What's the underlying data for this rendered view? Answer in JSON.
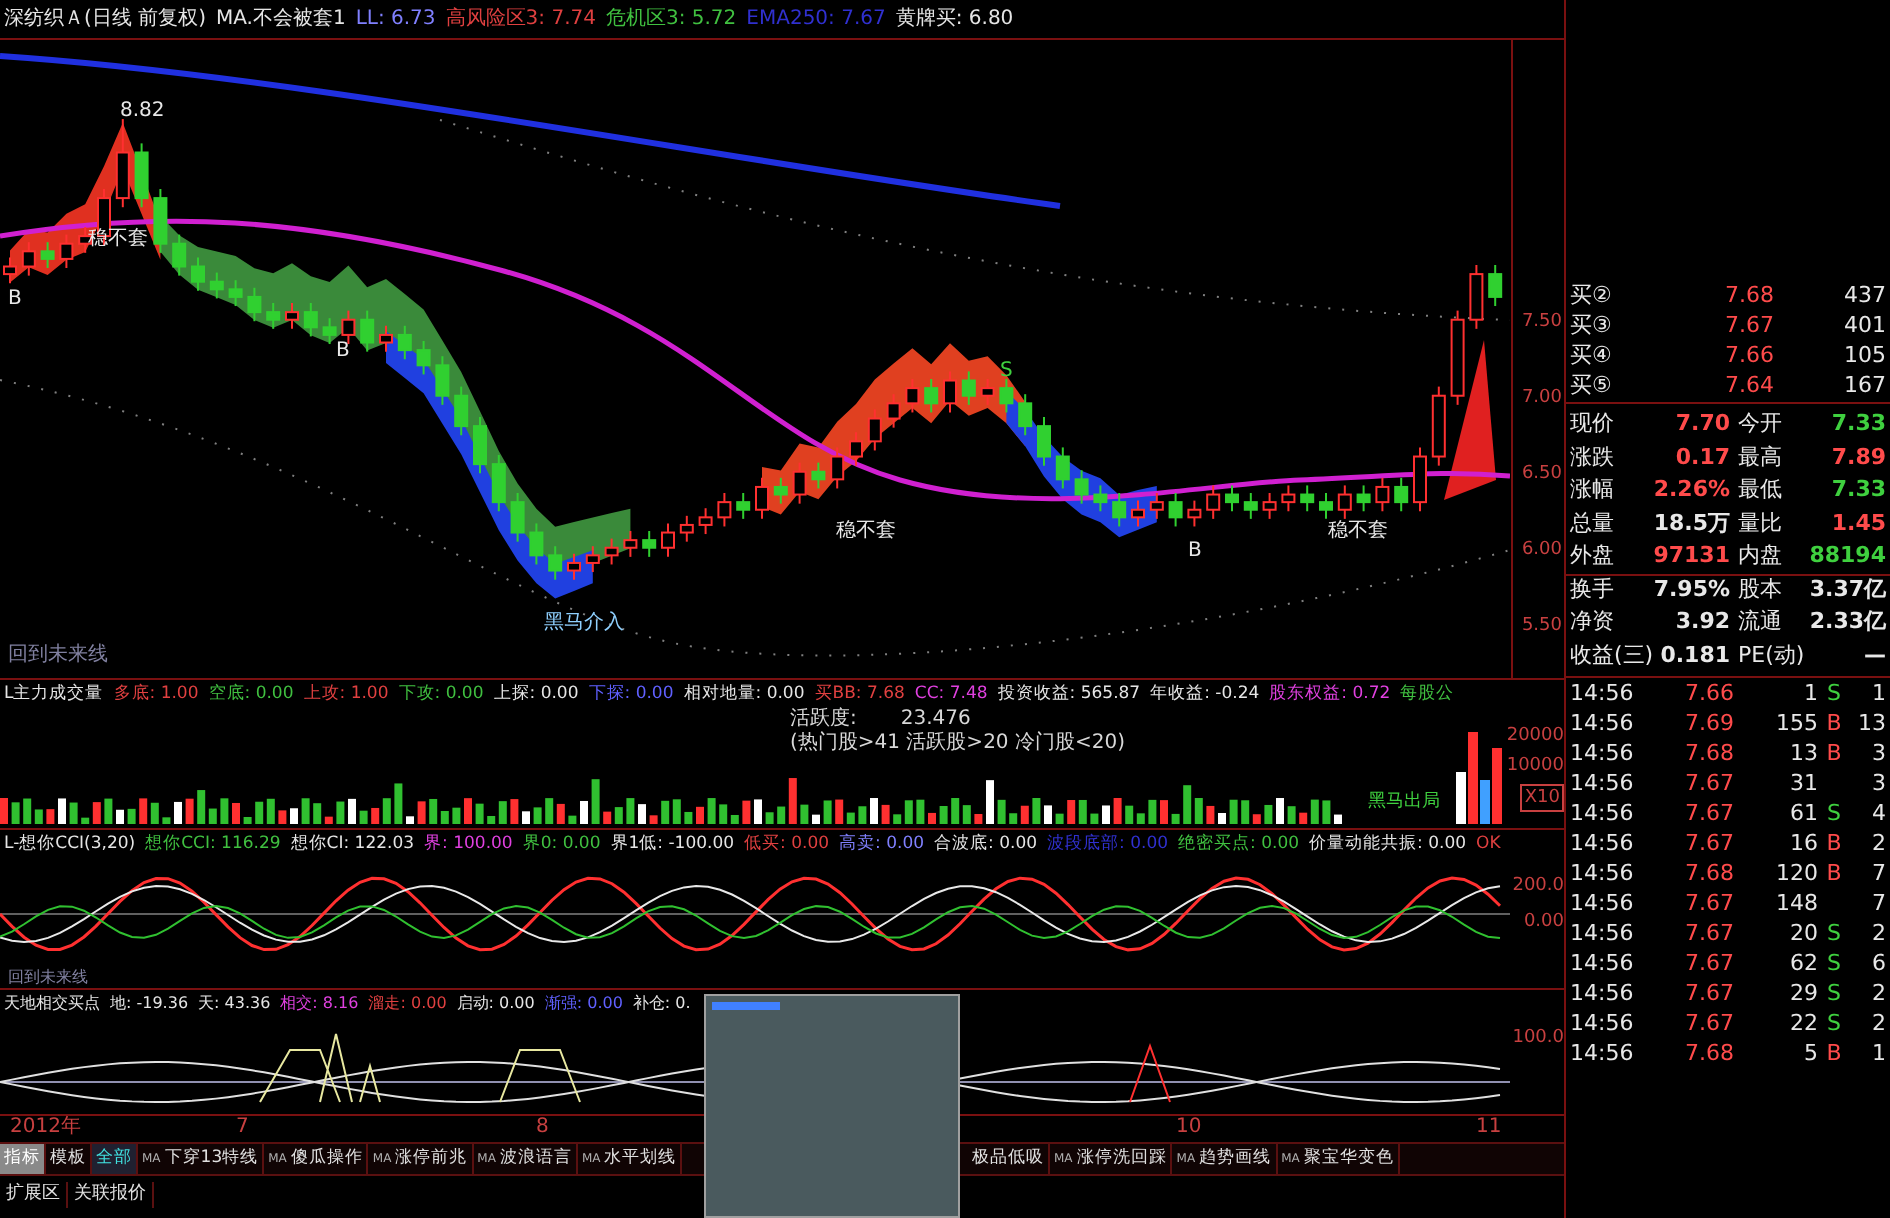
{
  "header": [
    {
      "text": "深纺织Ａ(日线 前复权)",
      "color": "#e5e5e5"
    },
    {
      "text": "MA.不会被套1",
      "color": "#e5e5e5"
    },
    {
      "text": "LL: 6.73",
      "color": "#8080ff"
    },
    {
      "text": "高风险区3: 7.74",
      "color": "#e04040"
    },
    {
      "text": "危机区3: 5.72",
      "color": "#40c040"
    },
    {
      "text": "EMA250: 7.67",
      "color": "#3030d0"
    },
    {
      "text": "黄牌买: 6.80",
      "color": "#e5e5e5"
    }
  ],
  "main_chart": {
    "labels": [
      "8.82",
      "稳不套",
      "B",
      "B",
      "S",
      "稳不套",
      "稳不套",
      "黑马介入",
      "B",
      "回到未来线"
    ],
    "chart_data": {
      "type": "candlestick",
      "ylim": [
        5.13,
        9.34
      ],
      "yticks": [
        {
          "value": 7.5,
          "label": "7.50"
        },
        {
          "value": 7,
          "label": "7.00"
        },
        {
          "value": 6.5,
          "label": "6.50"
        },
        {
          "value": 6,
          "label": "6.00"
        },
        {
          "value": 5.5,
          "label": "5.50"
        }
      ],
      "ohlc": [
        [
          7.8,
          7.91,
          7.74,
          7.85
        ],
        [
          7.85,
          8.01,
          7.79,
          7.95
        ],
        [
          7.95,
          8.01,
          7.84,
          7.9
        ],
        [
          7.9,
          8.06,
          7.84,
          8.0
        ],
        [
          8.0,
          8.11,
          7.94,
          8.05
        ],
        [
          8.05,
          8.36,
          7.99,
          8.3
        ],
        [
          8.3,
          8.82,
          8.24,
          8.6
        ],
        [
          8.6,
          8.66,
          8.24,
          8.3
        ],
        [
          8.3,
          8.36,
          7.94,
          8.0
        ],
        [
          8.0,
          8.06,
          7.79,
          7.85
        ],
        [
          7.85,
          7.91,
          7.69,
          7.75
        ],
        [
          7.75,
          7.81,
          7.64,
          7.7
        ],
        [
          7.7,
          7.76,
          7.59,
          7.65
        ],
        [
          7.65,
          7.71,
          7.49,
          7.55
        ],
        [
          7.55,
          7.61,
          7.44,
          7.5
        ],
        [
          7.5,
          7.61,
          7.44,
          7.55
        ],
        [
          7.55,
          7.61,
          7.39,
          7.45
        ],
        [
          7.45,
          7.51,
          7.34,
          7.4
        ],
        [
          7.4,
          7.56,
          7.34,
          7.5
        ],
        [
          7.5,
          7.56,
          7.29,
          7.35
        ],
        [
          7.35,
          7.46,
          7.29,
          7.4
        ],
        [
          7.4,
          7.46,
          7.24,
          7.3
        ],
        [
          7.3,
          7.36,
          7.14,
          7.2
        ],
        [
          7.2,
          7.26,
          6.94,
          7.0
        ],
        [
          7.0,
          7.06,
          6.74,
          6.8
        ],
        [
          6.8,
          6.86,
          6.49,
          6.55
        ],
        [
          6.55,
          6.61,
          6.24,
          6.3
        ],
        [
          6.3,
          6.36,
          6.04,
          6.1
        ],
        [
          6.1,
          6.16,
          5.89,
          5.95
        ],
        [
          5.95,
          6.01,
          5.79,
          5.85
        ],
        [
          5.85,
          5.96,
          5.79,
          5.9
        ],
        [
          5.9,
          6.01,
          5.84,
          5.95
        ],
        [
          5.95,
          6.06,
          5.89,
          6.0
        ],
        [
          6.0,
          6.11,
          5.94,
          6.05
        ],
        [
          6.05,
          6.11,
          5.94,
          6.0
        ],
        [
          6.0,
          6.16,
          5.94,
          6.1
        ],
        [
          6.1,
          6.21,
          6.04,
          6.15
        ],
        [
          6.15,
          6.26,
          6.09,
          6.2
        ],
        [
          6.2,
          6.36,
          6.14,
          6.3
        ],
        [
          6.3,
          6.36,
          6.19,
          6.25
        ],
        [
          6.25,
          6.46,
          6.19,
          6.4
        ],
        [
          6.4,
          6.46,
          6.29,
          6.35
        ],
        [
          6.35,
          6.56,
          6.29,
          6.5
        ],
        [
          6.5,
          6.56,
          6.39,
          6.45
        ],
        [
          6.45,
          6.66,
          6.39,
          6.6
        ],
        [
          6.6,
          6.76,
          6.54,
          6.7
        ],
        [
          6.7,
          6.91,
          6.64,
          6.85
        ],
        [
          6.85,
          7.01,
          6.79,
          6.95
        ],
        [
          6.95,
          7.11,
          6.89,
          7.05
        ],
        [
          7.05,
          7.11,
          6.89,
          6.95
        ],
        [
          6.95,
          7.16,
          6.89,
          7.1
        ],
        [
          7.1,
          7.16,
          6.94,
          7.0
        ],
        [
          7.0,
          7.11,
          6.94,
          7.05
        ],
        [
          7.05,
          7.11,
          6.89,
          6.95
        ],
        [
          6.95,
          7.01,
          6.74,
          6.8
        ],
        [
          6.8,
          6.86,
          6.54,
          6.6
        ],
        [
          6.6,
          6.66,
          6.39,
          6.45
        ],
        [
          6.45,
          6.51,
          6.29,
          6.35
        ],
        [
          6.35,
          6.41,
          6.24,
          6.3
        ],
        [
          6.3,
          6.36,
          6.14,
          6.2
        ],
        [
          6.2,
          6.31,
          6.14,
          6.25
        ],
        [
          6.25,
          6.36,
          6.19,
          6.3
        ],
        [
          6.3,
          6.36,
          6.14,
          6.2
        ],
        [
          6.2,
          6.31,
          6.14,
          6.25
        ],
        [
          6.25,
          6.41,
          6.19,
          6.35
        ],
        [
          6.35,
          6.41,
          6.24,
          6.3
        ],
        [
          6.3,
          6.36,
          6.19,
          6.25
        ],
        [
          6.25,
          6.36,
          6.19,
          6.3
        ],
        [
          6.3,
          6.41,
          6.24,
          6.35
        ],
        [
          6.35,
          6.41,
          6.24,
          6.3
        ],
        [
          6.3,
          6.36,
          6.19,
          6.25
        ],
        [
          6.25,
          6.41,
          6.19,
          6.35
        ],
        [
          6.35,
          6.41,
          6.24,
          6.3
        ],
        [
          6.3,
          6.46,
          6.24,
          6.4
        ],
        [
          6.4,
          6.46,
          6.24,
          6.3
        ],
        [
          6.3,
          6.66,
          6.24,
          6.6
        ],
        [
          6.6,
          7.06,
          6.54,
          7.0
        ],
        [
          7.0,
          7.56,
          6.94,
          7.5
        ],
        [
          7.5,
          7.86,
          7.44,
          7.8
        ],
        [
          7.8,
          7.86,
          7.59,
          7.65
        ]
      ]
    }
  },
  "volume_panel": {
    "header": [
      {
        "text": "L主力成交量",
        "color": "#e5e5e5"
      },
      {
        "text": "多底: 1.00",
        "color": "#e04040"
      },
      {
        "text": "空底: 0.00",
        "color": "#40c040"
      },
      {
        "text": "上攻: 1.00",
        "color": "#e04040"
      },
      {
        "text": "下攻: 0.00",
        "color": "#40c040"
      },
      {
        "text": "上探: 0.00",
        "color": "#e5e5e5"
      },
      {
        "text": "下探: 0.00",
        "color": "#6060ff"
      },
      {
        "text": "相对地量: 0.00",
        "color": "#e5e5e5"
      },
      {
        "text": "买BB: 7.68",
        "color": "#e04040"
      },
      {
        "text": "CC: 7.48",
        "color": "#e040e0"
      },
      {
        "text": "投资收益: 565.87",
        "color": "#e5e5e5"
      },
      {
        "text": "年收益: -0.24",
        "color": "#e5e5e5"
      },
      {
        "text": "股东权益: 0.72",
        "color": "#e040e0"
      },
      {
        "text": "每股公",
        "color": "#40c040"
      }
    ],
    "activity_label": "活跃度:",
    "activity_value": "23.476",
    "activity_note": "(热门股>41 活跃股>20 冷门股<20)",
    "signal": "黑马出局",
    "axis": [
      "20000",
      "10000",
      "X10"
    ]
  },
  "cci_panel": {
    "header": [
      {
        "text": "L-想你CCI(3,20)",
        "color": "#e5e5e5"
      },
      {
        "text": "想你CCI: 116.29",
        "color": "#40c040"
      },
      {
        "text": "想你CI: 122.03",
        "color": "#e5e5e5"
      },
      {
        "text": "界: 100.00",
        "color": "#e040e0"
      },
      {
        "text": "界0: 0.00",
        "color": "#40c040"
      },
      {
        "text": "界1低: -100.00",
        "color": "#e5e5e5"
      },
      {
        "text": "低买: 0.00",
        "color": "#e04040"
      },
      {
        "text": "高卖: 0.00",
        "color": "#8080ff"
      },
      {
        "text": "合波底: 0.00",
        "color": "#e5e5e5"
      },
      {
        "text": "波段底部: 0.00",
        "color": "#3030d0"
      },
      {
        "text": "绝密买点: 0.00",
        "color": "#40c040"
      },
      {
        "text": "价量动能共振: 0.00",
        "color": "#e5e5e5"
      },
      {
        "text": "OK",
        "color": "#e04040"
      }
    ],
    "axis": [
      "200.0",
      "0.00"
    ],
    "footnote": "回到未来线"
  },
  "date_axis": [
    "2012年",
    "7",
    "8",
    "10",
    "11"
  ],
  "cross_panel": {
    "header": [
      {
        "text": "天地相交买点",
        "color": "#e5e5e5"
      },
      {
        "text": "地: -19.36",
        "color": "#e5e5e5"
      },
      {
        "text": "天: 43.36",
        "color": "#e5e5e5"
      },
      {
        "text": "相交: 8.16",
        "color": "#e040e0"
      },
      {
        "text": "溜走: 0.00",
        "color": "#e04040"
      },
      {
        "text": "启动: 0.00",
        "color": "#e5e5e5"
      },
      {
        "text": "渐强: 0.00",
        "color": "#6060ff"
      },
      {
        "text": "补仓: 0.",
        "color": "#e5e5e5"
      }
    ],
    "axis": [
      "100.0"
    ]
  },
  "mode_tabs": [
    {
      "label": "指标",
      "selected": true
    },
    {
      "label": "模板",
      "selected": false
    }
  ],
  "formula_tabs": [
    {
      "label": "全部",
      "selected": true
    },
    {
      "prefix": "MA",
      "label": "下穿13特线",
      "selected": false
    },
    {
      "prefix": "MA",
      "label": "傻瓜操作",
      "selected": false
    },
    {
      "prefix": "MA",
      "label": "涨停前兆",
      "selected": false
    },
    {
      "prefix": "MA",
      "label": "波浪语言",
      "selected": false
    },
    {
      "prefix": "MA",
      "label": "水平划线",
      "selected": false
    }
  ],
  "formula_tabs_right": [
    {
      "label": "极品低吸",
      "selected": false
    },
    {
      "prefix": "MA",
      "label": "涨停洗回踩",
      "selected": false
    },
    {
      "prefix": "MA",
      "label": "趋势画线",
      "selected": false
    },
    {
      "prefix": "MA",
      "label": "聚宝华变色",
      "selected": false
    }
  ],
  "bottom_tabs": [
    "扩展区",
    "关联报价"
  ],
  "order_book": [
    {
      "label": "买②",
      "price": "7.68",
      "volume": "437"
    },
    {
      "label": "买③",
      "price": "7.67",
      "volume": "401"
    },
    {
      "label": "买④",
      "price": "7.66",
      "volume": "105"
    },
    {
      "label": "买⑤",
      "price": "7.64",
      "volume": "167"
    }
  ],
  "quotes": [
    [
      {
        "label": "现价",
        "value": "7.70",
        "color": "#ff4b4b"
      },
      {
        "label": "今开",
        "value": "7.33",
        "color": "#3fd03f"
      }
    ],
    [
      {
        "label": "涨跌",
        "value": "0.17",
        "color": "#ff4b4b"
      },
      {
        "label": "最高",
        "value": "7.89",
        "color": "#ff4b4b"
      }
    ],
    [
      {
        "label": "涨幅",
        "value": "2.26%",
        "color": "#ff4b4b"
      },
      {
        "label": "最低",
        "value": "7.33",
        "color": "#3fd03f"
      }
    ],
    [
      {
        "label": "总量",
        "value": "18.5万",
        "color": "#e8e8e8"
      },
      {
        "label": "量比",
        "value": "1.45",
        "color": "#ff4b4b"
      }
    ],
    [
      {
        "label": "外盘",
        "value": "97131",
        "color": "#ff4b4b"
      },
      {
        "label": "内盘",
        "value": "88194",
        "color": "#3fd03f"
      }
    ],
    [
      {
        "label": "换手",
        "value": "7.95%",
        "color": "#e8e8e8"
      },
      {
        "label": "股本",
        "value": "3.37亿",
        "color": "#e8e8e8"
      }
    ],
    [
      {
        "label": "净资",
        "value": "3.92",
        "color": "#e8e8e8"
      },
      {
        "label": "流通",
        "value": "2.33亿",
        "color": "#e8e8e8"
      }
    ],
    [
      {
        "label": "收益(三)",
        "value": "0.181",
        "color": "#e8e8e8"
      },
      {
        "label": "PE(动)",
        "value": "—",
        "color": "#e8e8e8"
      }
    ]
  ],
  "ticks": [
    {
      "time": "14:56",
      "price": "7.66",
      "volume": "1",
      "side": "S",
      "color": "#3fd03f",
      "count": "1"
    },
    {
      "time": "14:56",
      "price": "7.69",
      "volume": "155",
      "side": "B",
      "color": "#ff4b4b",
      "count": "13"
    },
    {
      "time": "14:56",
      "price": "7.68",
      "volume": "13",
      "side": "B",
      "color": "#ff4b4b",
      "count": "3"
    },
    {
      "time": "14:56",
      "price": "7.67",
      "volume": "31",
      "count": "3"
    },
    {
      "time": "14:56",
      "price": "7.67",
      "volume": "61",
      "side": "S",
      "color": "#3fd03f",
      "count": "4"
    },
    {
      "time": "14:56",
      "price": "7.67",
      "volume": "16",
      "side": "B",
      "color": "#ff4b4b",
      "count": "2"
    },
    {
      "time": "14:56",
      "price": "7.68",
      "volume": "120",
      "side": "B",
      "color": "#ff4b4b",
      "count": "7"
    },
    {
      "time": "14:56",
      "price": "7.67",
      "volume": "148",
      "count": "7"
    },
    {
      "time": "14:56",
      "price": "7.67",
      "volume": "20",
      "side": "S",
      "color": "#3fd03f",
      "count": "2"
    },
    {
      "time": "14:56",
      "price": "7.67",
      "volume": "62",
      "side": "S",
      "color": "#3fd03f",
      "count": "6"
    },
    {
      "time": "14:56",
      "price": "7.67",
      "volume": "29",
      "side": "S",
      "color": "#3fd03f",
      "count": "2"
    },
    {
      "time": "14:56",
      "price": "7.67",
      "volume": "22",
      "side": "S",
      "color": "#3fd03f",
      "count": "2"
    },
    {
      "time": "14:56",
      "price": "7.68",
      "volume": "5",
      "side": "B",
      "color": "#ff4b4b",
      "count": "1"
    }
  ]
}
